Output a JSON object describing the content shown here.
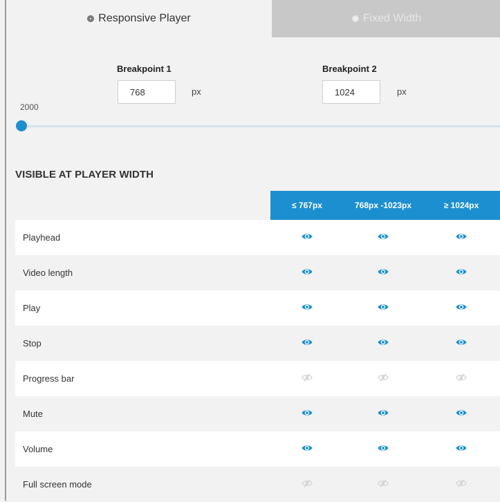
{
  "mode_tabs": {
    "responsive_label": "Responsive Player",
    "fixed_label": "Fixed Width",
    "selected": "responsive"
  },
  "breakpoints": {
    "bp1": {
      "label": "Breakpoint 1",
      "value": "768",
      "unit": "px"
    },
    "bp2": {
      "label": "Breakpoint 2",
      "value": "1024",
      "unit": "px"
    }
  },
  "slider": {
    "value_label": "2000",
    "position": 0
  },
  "visibility": {
    "title": "VISIBLE AT PLAYER WIDTH",
    "columns": [
      "≤ 767px",
      "768px -1023px",
      "≥ 1024px"
    ],
    "rows": [
      {
        "label": "Playhead",
        "visible": [
          true,
          true,
          true
        ]
      },
      {
        "label": "Video length",
        "visible": [
          true,
          true,
          true
        ]
      },
      {
        "label": "Play",
        "visible": [
          true,
          true,
          true
        ]
      },
      {
        "label": "Stop",
        "visible": [
          true,
          true,
          true
        ]
      },
      {
        "label": "Progress bar",
        "visible": [
          false,
          false,
          false
        ]
      },
      {
        "label": "Mute",
        "visible": [
          true,
          true,
          true
        ]
      },
      {
        "label": "Volume",
        "visible": [
          true,
          true,
          true
        ]
      },
      {
        "label": "Full screen mode",
        "visible": [
          false,
          false,
          false
        ]
      }
    ]
  },
  "colors": {
    "accent": "#1c8fd0",
    "eye_visible": "#1c8fd0",
    "eye_hidden": "#d4d4d4",
    "slider_handle": "#1f8ecf"
  },
  "icons": {
    "visible": "eye-icon",
    "hidden": "eye-slash-icon"
  }
}
